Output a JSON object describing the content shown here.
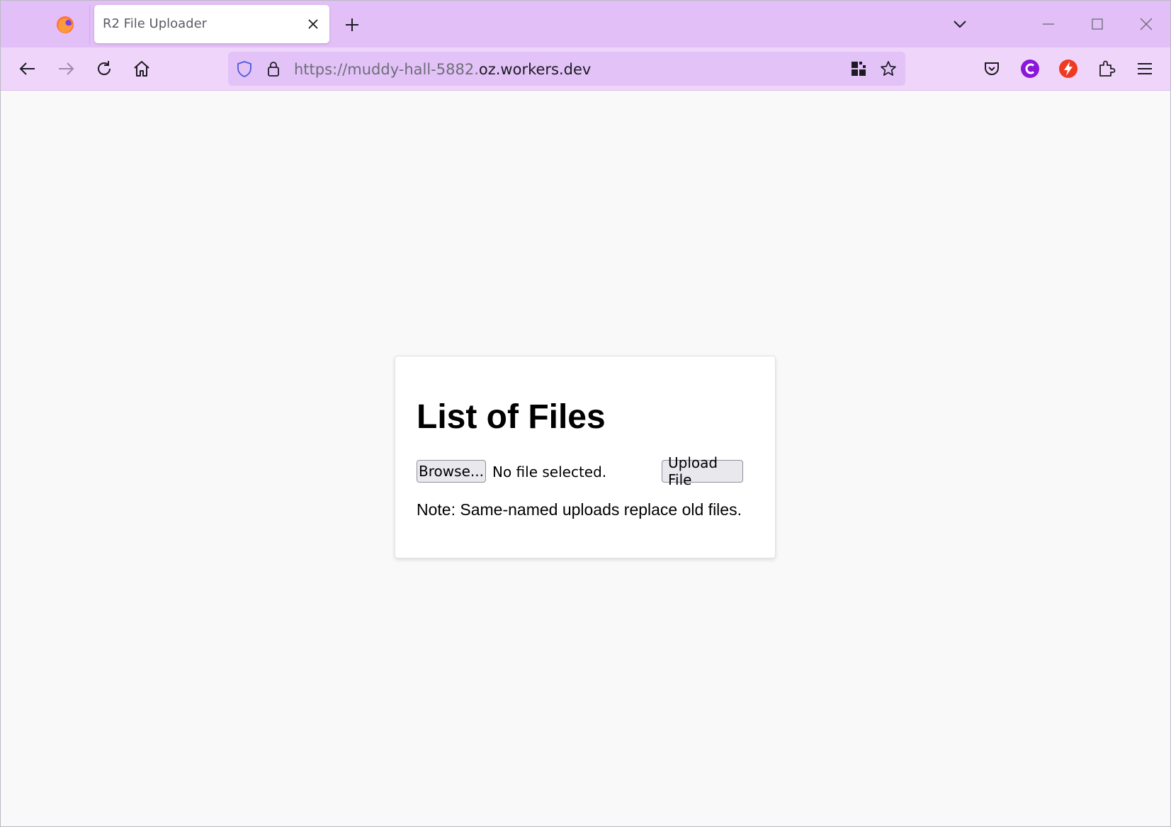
{
  "browser": {
    "tab": {
      "title": "R2 File Uploader"
    },
    "url": {
      "prefix": "https://muddy-hall-5882.",
      "domain": "oz.workers.dev"
    },
    "accent_color": "#e3bff8"
  },
  "icons": {
    "tabbar": [
      "firefox-icon",
      "close-icon",
      "plus-icon",
      "chevron-down-icon",
      "minimize-icon",
      "maximize-icon",
      "close-window-icon"
    ],
    "navbar": [
      "back-icon",
      "forward-icon",
      "reload-icon",
      "home-icon",
      "shield-icon",
      "lock-icon",
      "qr-code-icon",
      "star-icon",
      "pocket-icon",
      "c-extension-icon",
      "flash-extension-icon",
      "extensions-puzzle-icon",
      "menu-icon"
    ]
  },
  "page": {
    "heading": "List of Files",
    "browse_label": "Browse...",
    "file_status": "No file selected.",
    "upload_label": "Upload File",
    "note": "Note: Same-named uploads replace old files."
  }
}
